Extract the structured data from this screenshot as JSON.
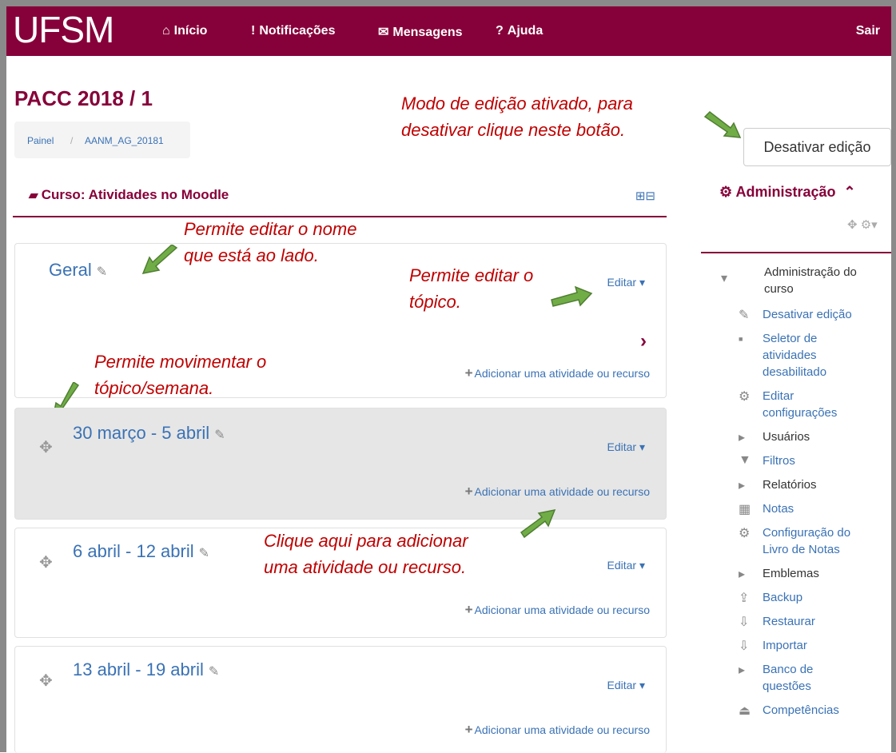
{
  "navbar": {
    "logo": "UFSM",
    "items": [
      {
        "icon": "home-icon",
        "glyph": "⌂",
        "label": "Início"
      },
      {
        "icon": "notification-icon",
        "glyph": "!",
        "label": "Notificações"
      },
      {
        "icon": "mail-icon",
        "glyph": "✉",
        "label": "Mensagens"
      },
      {
        "icon": "help-icon",
        "glyph": "?",
        "label": "Ajuda"
      }
    ],
    "logout": "Sair"
  },
  "page": {
    "title": "PACC 2018 / 1",
    "breadcrumb": [
      "Painel",
      "/",
      "AANM_AG_20181"
    ],
    "edit_button": "Desativar edição"
  },
  "annotations": {
    "edit_mode": [
      "Modo de edição ativado, para",
      "desativar clique neste botão."
    ],
    "edit_name": [
      "Permite editar o nome",
      "que está ao lado."
    ],
    "edit_topic": [
      "Permite editar o",
      "tópico."
    ],
    "move_topic": [
      "Permite movimentar o",
      "tópico/semana."
    ],
    "add_activity": [
      "Clique aqui para adicionar",
      "uma atividade ou recurso."
    ]
  },
  "course": {
    "title": "Curso: Atividades no Moodle",
    "sections": [
      {
        "title": "Geral",
        "edit": "Editar",
        "add": "Adicionar uma atividade ou recurso"
      },
      {
        "title": "30 março - 5 abril",
        "edit": "Editar",
        "add": "Adicionar uma atividade ou recurso"
      },
      {
        "title": "6 abril - 12 abril",
        "edit": "Editar",
        "add": "Adicionar uma atividade ou recurso"
      },
      {
        "title": "13 abril - 19 abril",
        "edit": "Editar",
        "add": "Adicionar uma atividade ou recurso"
      }
    ]
  },
  "sidebar": {
    "title": "Administração",
    "root": [
      "Administração do",
      "curso"
    ],
    "items": [
      {
        "icon": "pencil-icon",
        "lines": [
          "Desativar edição"
        ],
        "link": true
      },
      {
        "icon": "bullet-icon",
        "lines": [
          "Seletor de",
          "atividades",
          "desabilitado"
        ],
        "link": true
      },
      {
        "icon": "gear-icon",
        "lines": [
          "Editar",
          "configurações"
        ],
        "link": true
      },
      {
        "icon": "triangle-icon",
        "lines": [
          "Usuários"
        ],
        "link": false
      },
      {
        "icon": "filter-icon",
        "lines": [
          "Filtros"
        ],
        "link": true
      },
      {
        "icon": "triangle-icon",
        "lines": [
          "Relatórios"
        ],
        "link": false
      },
      {
        "icon": "table-icon",
        "lines": [
          "Notas"
        ],
        "link": true
      },
      {
        "icon": "gear-icon",
        "lines": [
          "Configuração do",
          "Livro de Notas"
        ],
        "link": true
      },
      {
        "icon": "triangle-icon",
        "lines": [
          "Emblemas"
        ],
        "link": false
      },
      {
        "icon": "upload-icon",
        "lines": [
          "Backup"
        ],
        "link": true
      },
      {
        "icon": "download-icon",
        "lines": [
          "Restaurar"
        ],
        "link": true
      },
      {
        "icon": "download-icon",
        "lines": [
          "Importar"
        ],
        "link": true
      },
      {
        "icon": "triangle-icon",
        "lines": [
          "Banco de",
          "questões"
        ],
        "link": true
      },
      {
        "icon": "eject-icon",
        "lines": [
          "Competências"
        ],
        "link": true
      }
    ]
  },
  "colors": {
    "brand": "#860039",
    "link": "#3a72b5",
    "annotation": "#c00000",
    "arrow": "#70ad47"
  }
}
